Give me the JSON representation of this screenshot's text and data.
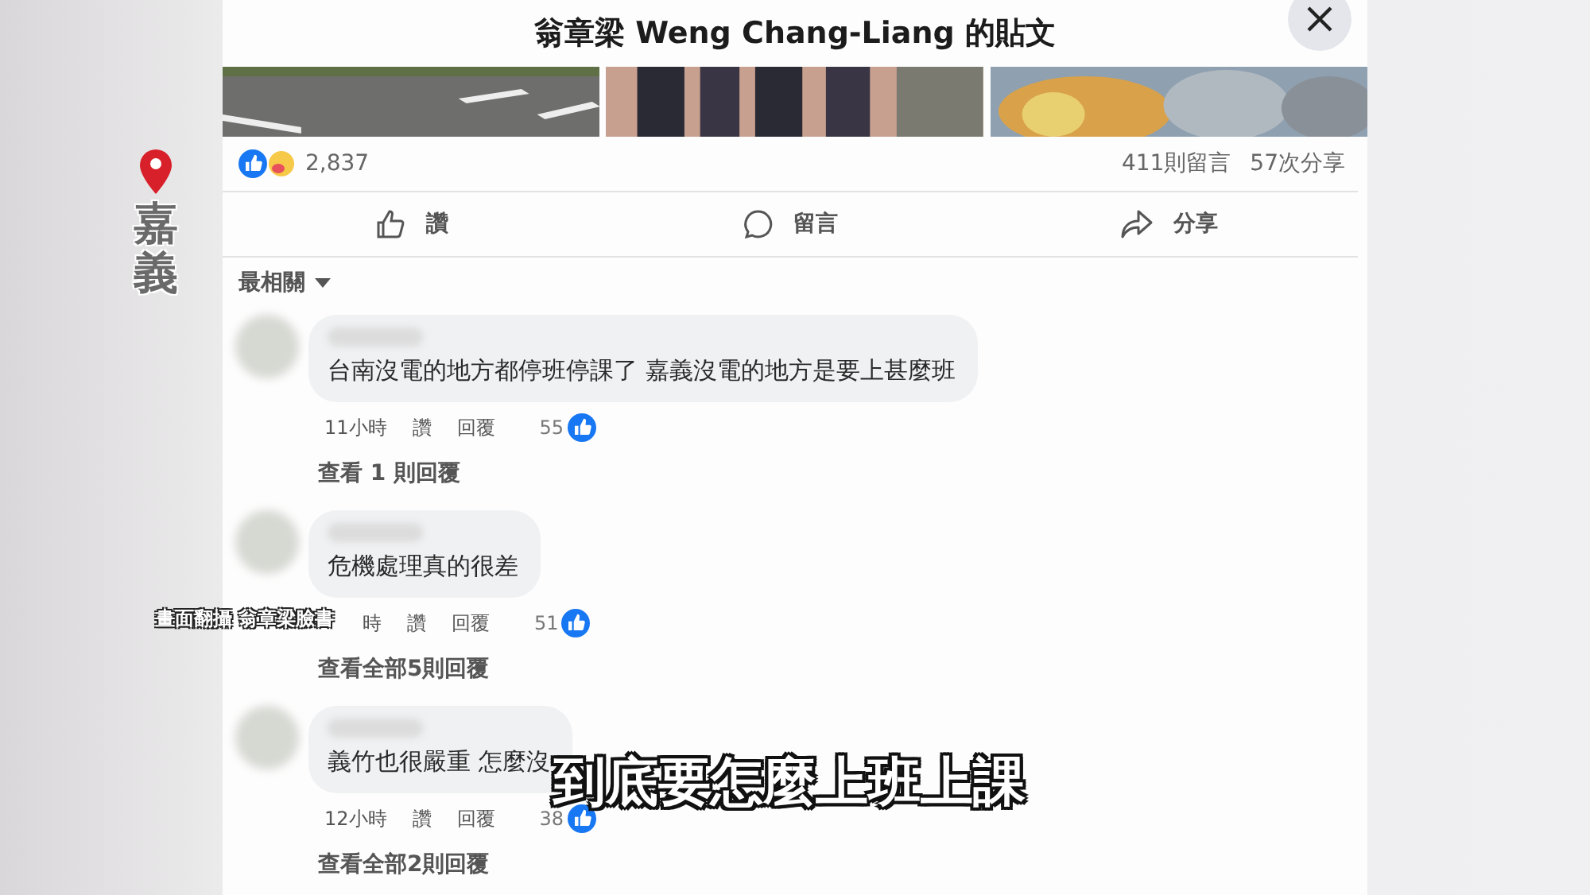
{
  "post_dialog": {
    "title": "翁章梁 Weng Chang-Liang 的貼文",
    "reaction_count": "2,837",
    "comment_count": "411則留言",
    "share_count": "57次分享",
    "actions": [
      "讚",
      "留言",
      "分享"
    ],
    "sort": "最相關",
    "comments": [
      {
        "text": "台南沒電的地方都停班停課了 嘉義沒電的地方是要上甚麼班",
        "time": "11小時",
        "like": "讚",
        "reply": "回覆",
        "likes": "55",
        "view_replies": "查看 1 則回覆"
      },
      {
        "text": "危機處理真的很差",
        "time": "時",
        "like": "讚",
        "reply": "回覆",
        "likes": "51",
        "view_replies": "查看全部5則回覆"
      },
      {
        "text": "義竹也很嚴重 怎麼沒",
        "time": "12小時",
        "like": "讚",
        "reply": "回覆",
        "likes": "38",
        "view_replies": "查看全部2則回覆"
      }
    ]
  },
  "overlays": {
    "location": "嘉義",
    "credit": "畫面翻攝 翁章梁臉書",
    "subtitle": "到底要怎麼上班上課"
  }
}
